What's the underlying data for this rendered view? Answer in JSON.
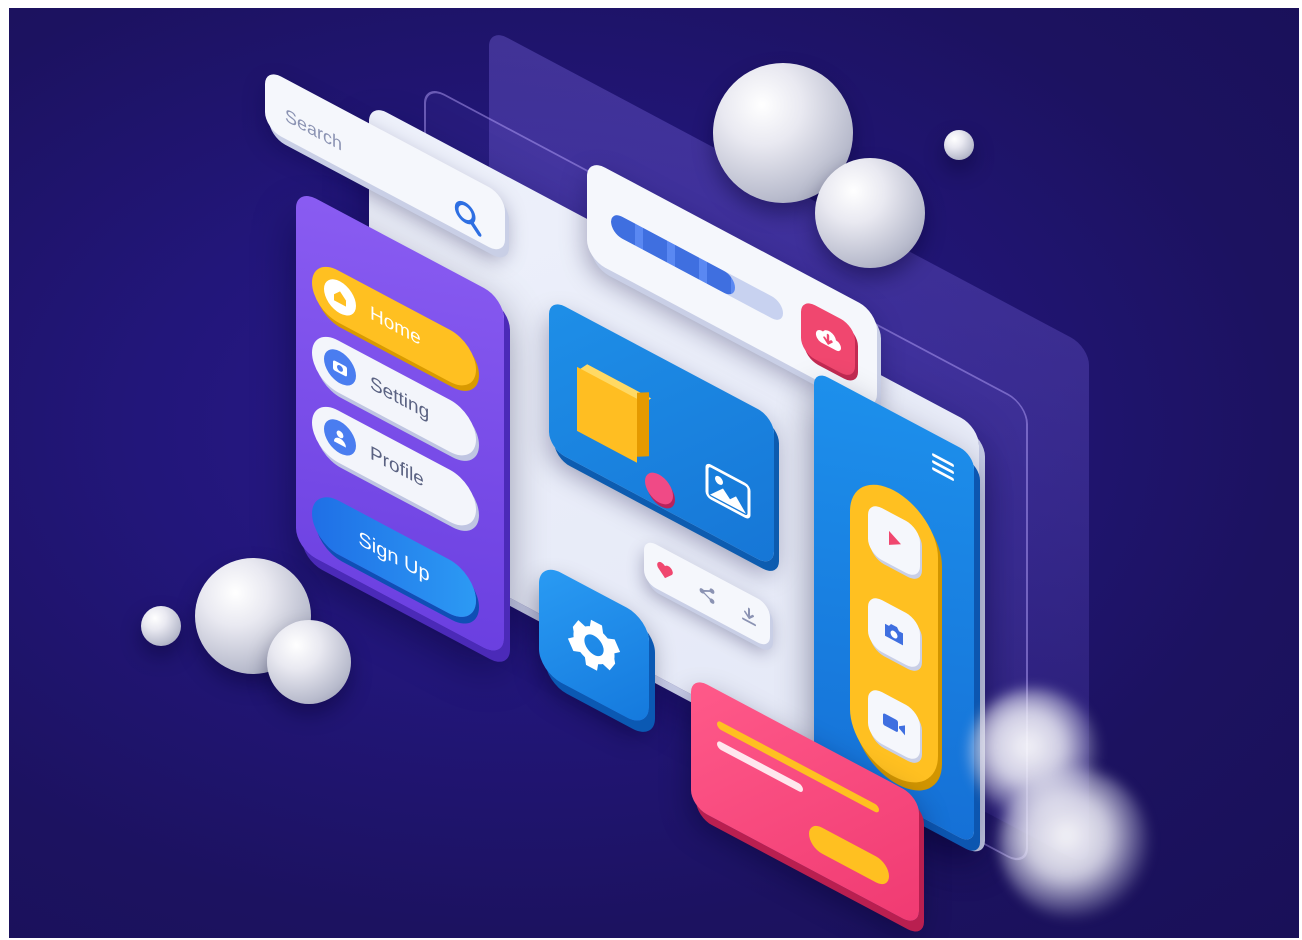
{
  "search": {
    "placeholder": "Search"
  },
  "nav": {
    "items": [
      {
        "label": "Home",
        "icon": "home-icon",
        "active": true
      },
      {
        "label": "Setting",
        "icon": "camera-icon",
        "active": false
      },
      {
        "label": "Profile",
        "icon": "user-icon",
        "active": false
      }
    ],
    "signup_label": "Sign Up"
  },
  "download": {
    "progress": 0.72,
    "icon": "cloud-download-icon"
  },
  "media": {
    "buttons": [
      "play-icon",
      "camera-icon",
      "video-icon"
    ]
  },
  "actions": [
    "heart-icon",
    "share-icon",
    "download-icon"
  ],
  "colors": {
    "background": "#22167a",
    "nav_purple": "#7b4df0",
    "accent_yellow": "#ffc021",
    "accent_blue": "#1e8fe8",
    "accent_pink": "#f0476f"
  }
}
